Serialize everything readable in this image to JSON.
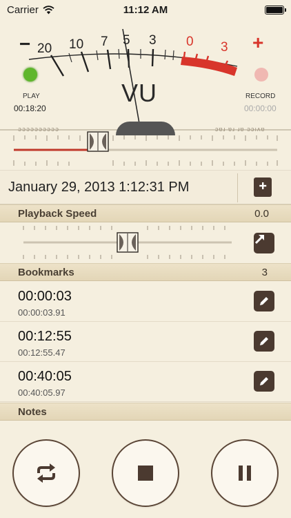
{
  "status": {
    "carrier": "Carrier",
    "time": "11:12 AM"
  },
  "meter": {
    "minus": "−",
    "plus": "+",
    "scale_labels": [
      "20",
      "10",
      "7",
      "5",
      "3",
      "0",
      "3"
    ],
    "vu": "VU",
    "play_label": "PLAY",
    "play_time": "00:18:20",
    "record_label": "RECORD",
    "record_time": "00:00:00",
    "play_led_color": "#5fb62c",
    "record_led_color": "#f0b8b2",
    "red_zone_color": "#d8352b",
    "scale_left_text": "əəǝəəəǝǝəə",
    "scale_right_text": "ɔɐɹ ɐɹ ɹɐ ǝɔıʌɐ"
  },
  "scrubber": {
    "progress": 0.32,
    "fill_color": "#c0392b"
  },
  "date": {
    "text": "January 29, 2013 1:12:31 PM",
    "bookmark_add_icon": "bookmark-plus-icon"
  },
  "playback_speed": {
    "title": "Playback Speed",
    "value": "0.0",
    "slider_position": 0.5,
    "expand_icon": "arrow-up-right-icon"
  },
  "bookmarks": {
    "title": "Bookmarks",
    "count": "3",
    "items": [
      {
        "time": "00:00:03",
        "precise": "00:00:03.91"
      },
      {
        "time": "00:12:55",
        "precise": "00:12:55.47"
      },
      {
        "time": "00:40:05",
        "precise": "00:40:05.97"
      }
    ],
    "edit_icon": "pencil-icon"
  },
  "notes": {
    "title": "Notes"
  },
  "transport": {
    "repeat_icon": "repeat-icon",
    "stop_icon": "stop-icon",
    "pause_icon": "pause-icon",
    "accent": "#4b3a30"
  }
}
